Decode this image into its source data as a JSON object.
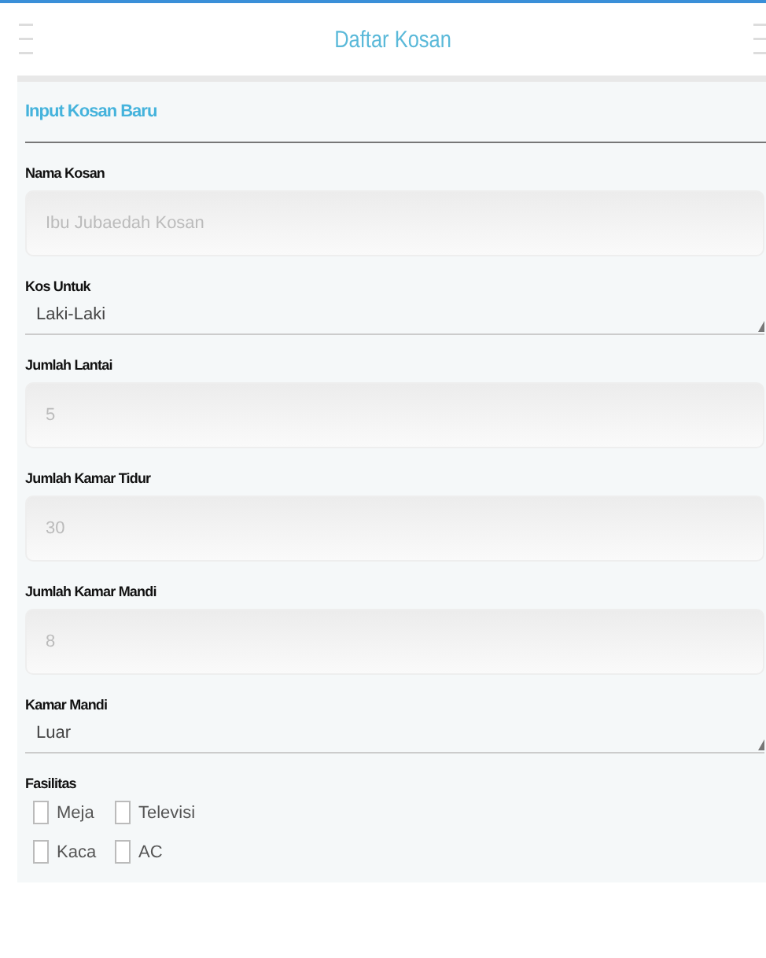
{
  "header": {
    "title": "Daftar Kosan"
  },
  "form": {
    "title": "Input Kosan Baru",
    "fields": [
      {
        "kind": "input",
        "label": "Nama Kosan",
        "placeholder": "Ibu Jubaedah Kosan"
      },
      {
        "kind": "select",
        "label": "Kos Untuk",
        "value": "Laki-Laki"
      },
      {
        "kind": "input",
        "label": "Jumlah Lantai",
        "placeholder": "5"
      },
      {
        "kind": "input",
        "label": "Jumlah Kamar Tidur",
        "placeholder": "30"
      },
      {
        "kind": "input",
        "label": "Jumlah Kamar Mandi",
        "placeholder": "8"
      },
      {
        "kind": "select",
        "label": "Kamar Mandi",
        "value": "Luar"
      }
    ],
    "facilities": {
      "label": "Fasilitas",
      "options": [
        {
          "label": "Meja",
          "checked": false
        },
        {
          "label": "Televisi",
          "checked": false
        },
        {
          "label": "Kaca",
          "checked": false
        },
        {
          "label": "AC",
          "checked": false
        }
      ]
    }
  }
}
